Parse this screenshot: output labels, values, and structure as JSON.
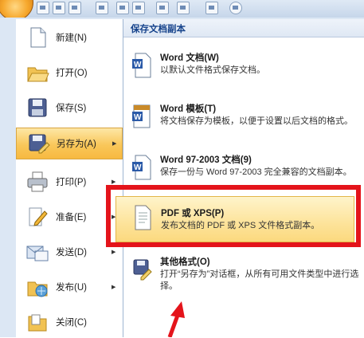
{
  "left_menu": [
    {
      "label": "新建(N)",
      "icon": "new-document-icon",
      "arrow": false,
      "selected": false
    },
    {
      "label": "打开(O)",
      "icon": "open-folder-icon",
      "arrow": false,
      "selected": false
    },
    {
      "label": "保存(S)",
      "icon": "save-disk-icon",
      "arrow": false,
      "selected": false
    },
    {
      "label": "另存为(A)",
      "icon": "save-as-icon",
      "arrow": true,
      "selected": true
    },
    {
      "label": "打印(P)",
      "icon": "printer-icon",
      "arrow": true,
      "selected": false
    },
    {
      "label": "准备(E)",
      "icon": "prepare-pen-icon",
      "arrow": true,
      "selected": false
    },
    {
      "label": "发送(D)",
      "icon": "send-icon",
      "arrow": true,
      "selected": false
    },
    {
      "label": "发布(U)",
      "icon": "publish-icon",
      "arrow": true,
      "selected": false
    },
    {
      "label": "关闭(C)",
      "icon": "close-folder-icon",
      "arrow": false,
      "selected": false
    }
  ],
  "right_panel": {
    "header": "保存文档副本",
    "items": [
      {
        "title": "Word 文档(W)",
        "desc": "以默认文件格式保存文档。",
        "icon": "word-document-icon"
      },
      {
        "title": "Word 模板(T)",
        "desc": "将文档保存为模板，以便于设置以后文档的格式。",
        "icon": "word-template-icon"
      },
      {
        "title": "Word 97-2003 文档(9)",
        "desc": "保存一份与 Word 97-2003 完全兼容的文档副本。",
        "icon": "word-97-2003-icon"
      },
      {
        "title": "PDF 或 XPS(P)",
        "desc": "发布文档的 PDF 或 XPS 文件格式副本。",
        "icon": "pdf-xps-icon",
        "highlighted": true
      },
      {
        "title": "其他格式(O)",
        "desc": "打开“另存为”对话框，从所有可用文件类型中进行选择。",
        "icon": "other-formats-icon"
      }
    ]
  },
  "colors": {
    "highlight_box": "#e4141b",
    "selected_menu": "#f9c75a"
  }
}
